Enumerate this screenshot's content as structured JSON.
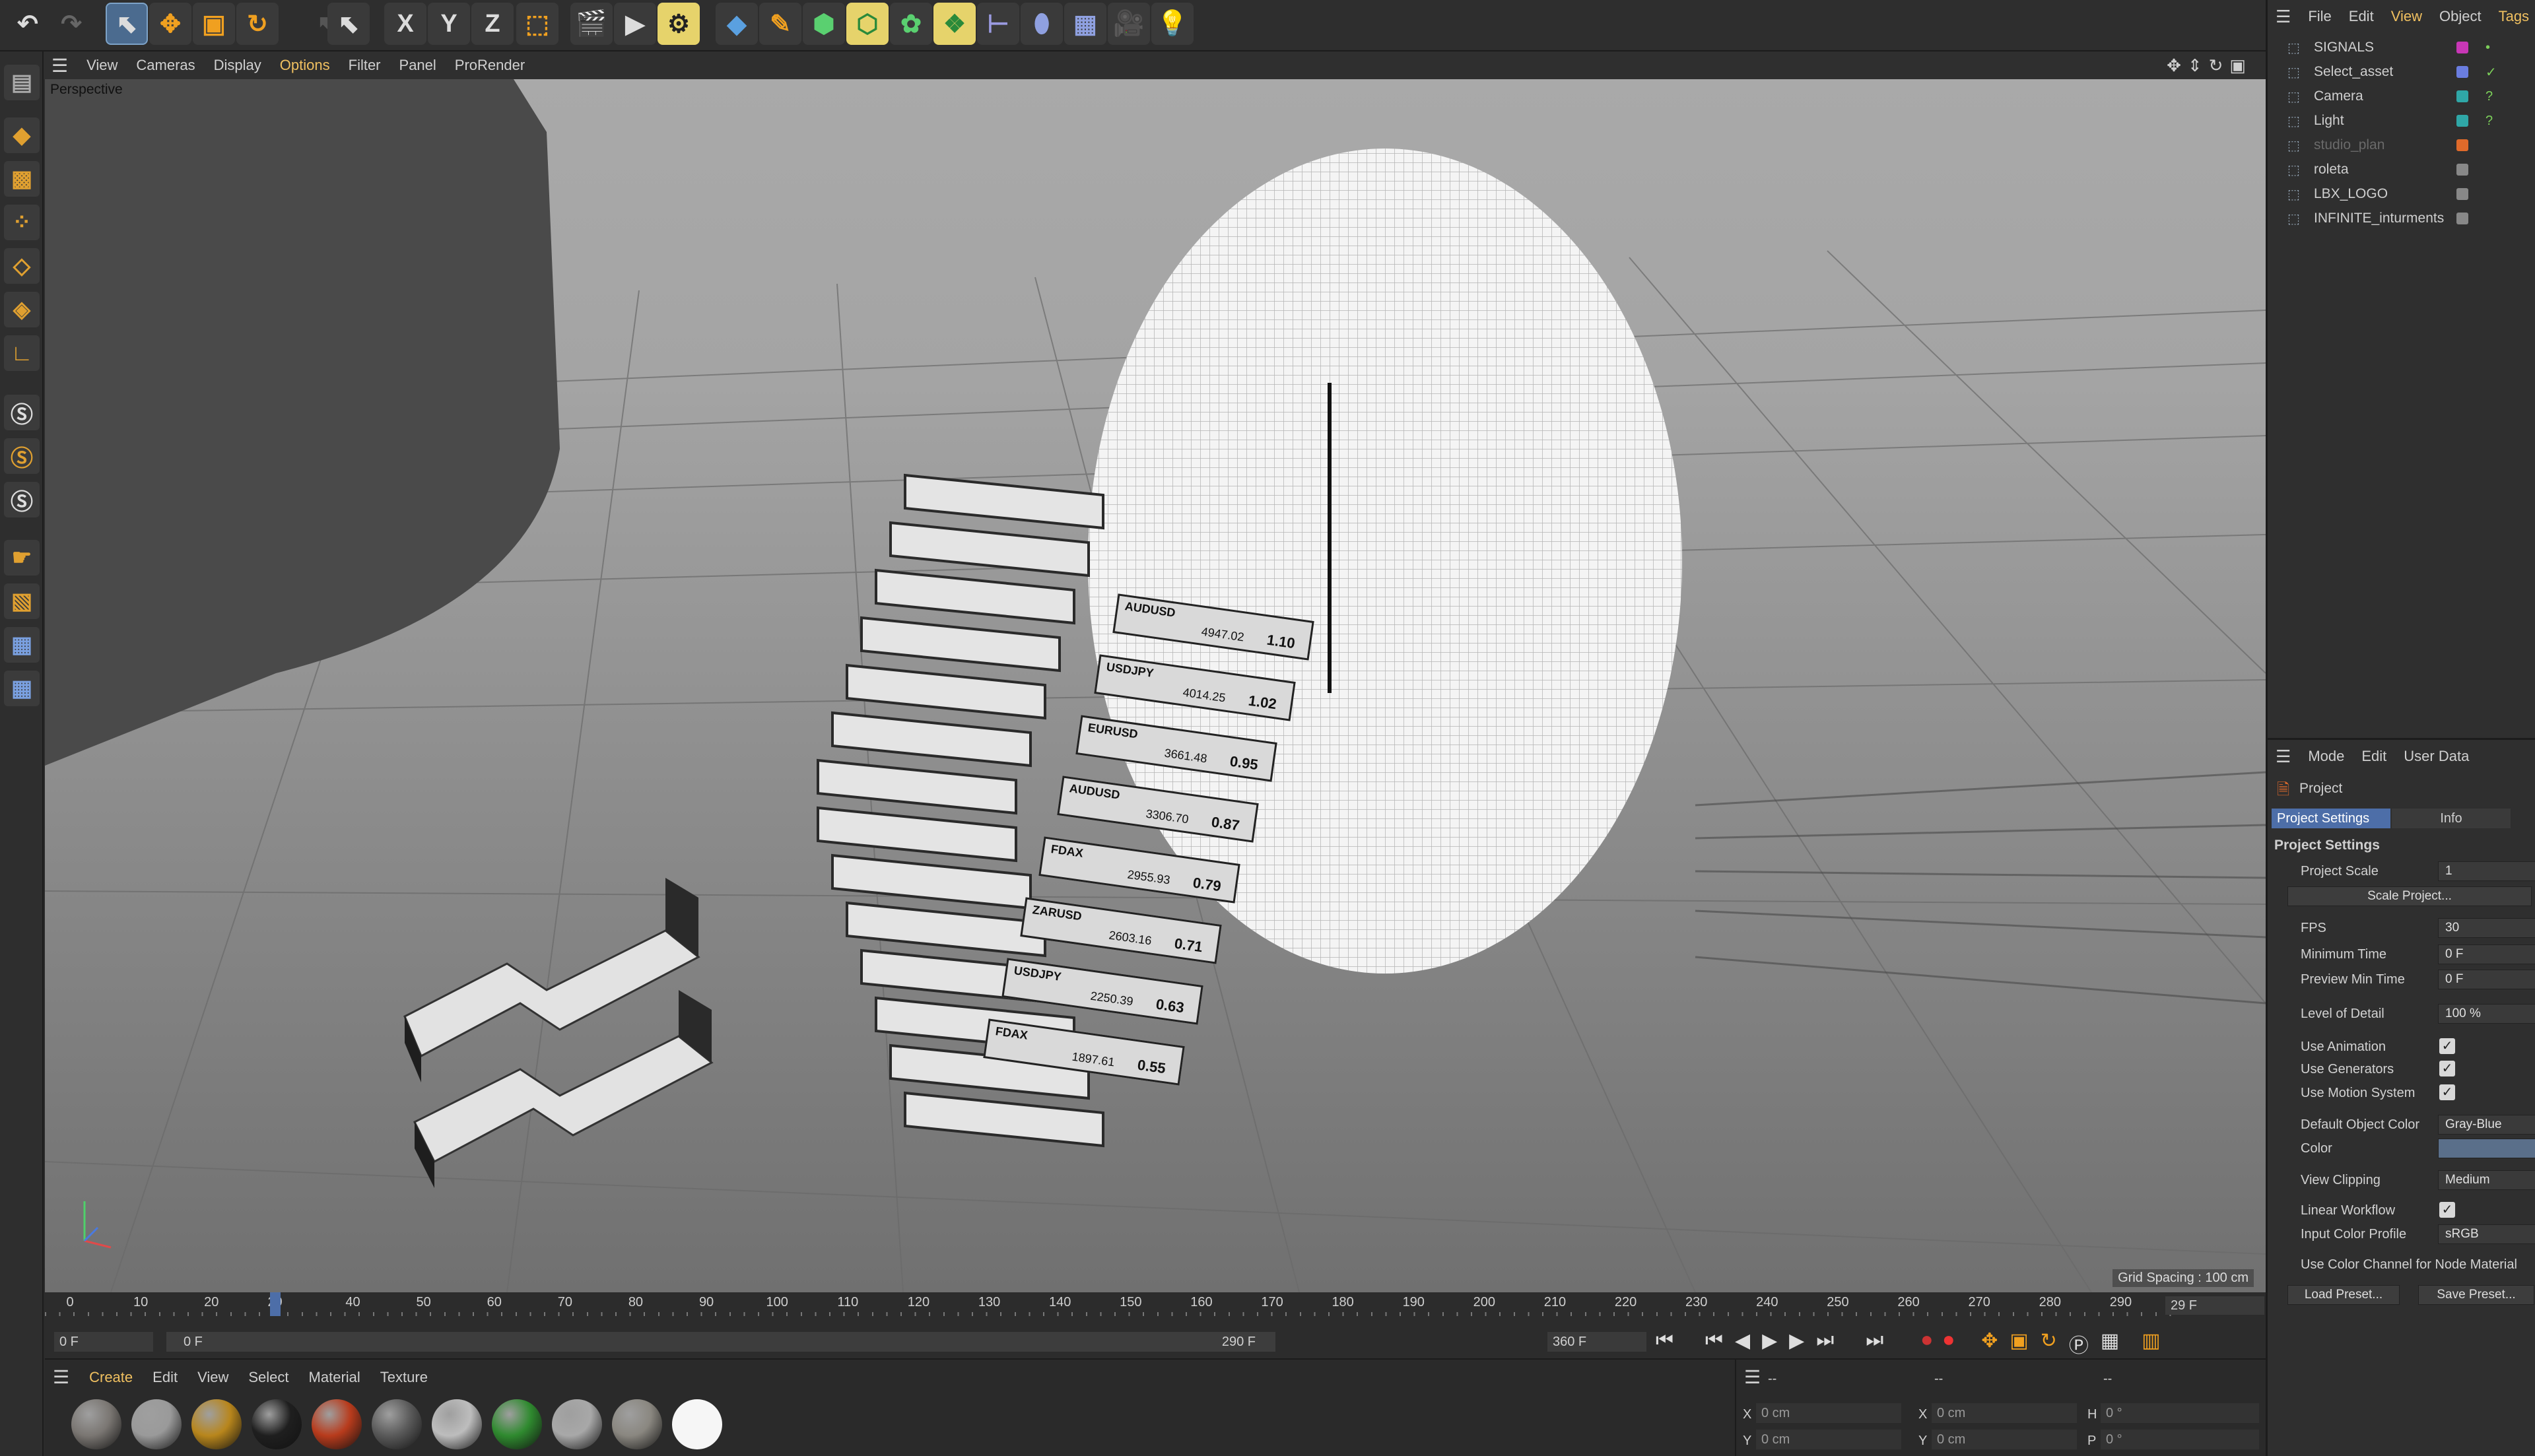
{
  "viewport_menu": {
    "items": [
      "View",
      "Cameras",
      "Display",
      "Options",
      "Filter",
      "Panel",
      "ProRender"
    ],
    "active": "Options"
  },
  "viewport": {
    "label": "Perspective",
    "grid_spacing": "Grid Spacing : 100 cm"
  },
  "axis_buttons": [
    "X",
    "Y",
    "Z"
  ],
  "object_manager": {
    "menu": [
      "File",
      "Edit",
      "View",
      "Object",
      "Tags"
    ],
    "objects": [
      {
        "name": "SIGNALS",
        "tag_color": "#c837b6",
        "check": "•"
      },
      {
        "name": "Select_asset",
        "tag_color": "#6a7de0",
        "check": "✓"
      },
      {
        "name": "Camera",
        "tag_color": "#2fa7a7",
        "check": "?"
      },
      {
        "name": "Light",
        "tag_color": "#2fa7a7",
        "check": "?"
      },
      {
        "name": "studio_plan",
        "tag_color": "#e06a2a",
        "check": ""
      },
      {
        "name": "roleta",
        "tag_color": "#888888",
        "check": ""
      },
      {
        "name": "LBX_LOGO",
        "tag_color": "#888888",
        "check": ""
      },
      {
        "name": "INFINITE_inturments",
        "tag_color": "#888888",
        "check": ""
      }
    ]
  },
  "attribute_manager": {
    "menu": [
      "Mode",
      "Edit",
      "User Data"
    ],
    "title": "Project",
    "tabs": [
      "Project Settings",
      "Info"
    ],
    "section": "Project Settings",
    "fields": {
      "project_scale_label": "Project Scale",
      "project_scale": "1",
      "scale_project_btn": "Scale Project...",
      "fps_label": "FPS",
      "fps": "30",
      "min_time_label": "Minimum Time",
      "min_time": "0 F",
      "preview_min_label": "Preview Min Time",
      "preview_min": "0 F",
      "lod_label": "Level of Detail",
      "lod": "100 %",
      "use_animation": "Use Animation",
      "use_generators": "Use Generators",
      "use_motion": "Use Motion System",
      "default_color_label": "Default Object Color",
      "default_color": "Gray-Blue",
      "color_label": "Color",
      "view_clipping_label": "View Clipping",
      "view_clipping": "Medium",
      "linear_workflow": "Linear Workflow",
      "input_profile_label": "Input Color Profile",
      "input_profile": "sRGB",
      "color_channel": "Use Color Channel for Node Material",
      "load_preset": "Load Preset...",
      "save_preset": "Save Preset..."
    }
  },
  "timeline": {
    "ticks": [
      "0",
      "10",
      "20",
      "29",
      "40",
      "50",
      "60",
      "70",
      "80",
      "90",
      "100",
      "110",
      "120",
      "130",
      "140",
      "150",
      "160",
      "170",
      "180",
      "190",
      "200",
      "210",
      "220",
      "230",
      "240",
      "250",
      "260",
      "270",
      "280",
      "290"
    ],
    "current": "29 F",
    "start": "0 F",
    "range_start": "0 F",
    "range_end": "290 F",
    "end": "360 F",
    "current_frame": 29
  },
  "material_manager": {
    "menu": [
      "Create",
      "Edit",
      "View",
      "Select",
      "Material",
      "Texture"
    ],
    "materials": [
      "#7a7672",
      "#9a9a9a",
      "#b8861c",
      "#1f1f1f",
      "#b83b1c",
      "#5a5a5a",
      "#bdbdbd",
      "#2f8a2f",
      "#a8a8a8",
      "#8a8780",
      "#f2f2f2"
    ]
  },
  "coordinates": {
    "x": "0 cm",
    "y": "0 cm",
    "x2": "0 cm",
    "y2": "0 cm",
    "h": "0 °",
    "p": "0 °",
    "lx": "X",
    "ly": "Y",
    "lx2": "X",
    "ly2": "Y",
    "lh": "H",
    "lp": "P",
    "dash": "--"
  },
  "ticker_rows": [
    {
      "sym": "AUDUSD",
      "price": "4947.02",
      "val": "1.10"
    },
    {
      "sym": "USDJPY",
      "price": "4014.25",
      "val": "1.02"
    },
    {
      "sym": "EURUSD",
      "price": "3661.48",
      "val": "0.95"
    },
    {
      "sym": "AUDUSD",
      "price": "3306.70",
      "val": "0.87"
    },
    {
      "sym": "FDAX",
      "price": "2955.93",
      "val": "0.79"
    },
    {
      "sym": "ZARUSD",
      "price": "2603.16",
      "val": "0.71"
    },
    {
      "sym": "USDJPY",
      "price": "2250.39",
      "val": "0.63"
    },
    {
      "sym": "FDAX",
      "price": "1897.61",
      "val": "0.55"
    }
  ]
}
